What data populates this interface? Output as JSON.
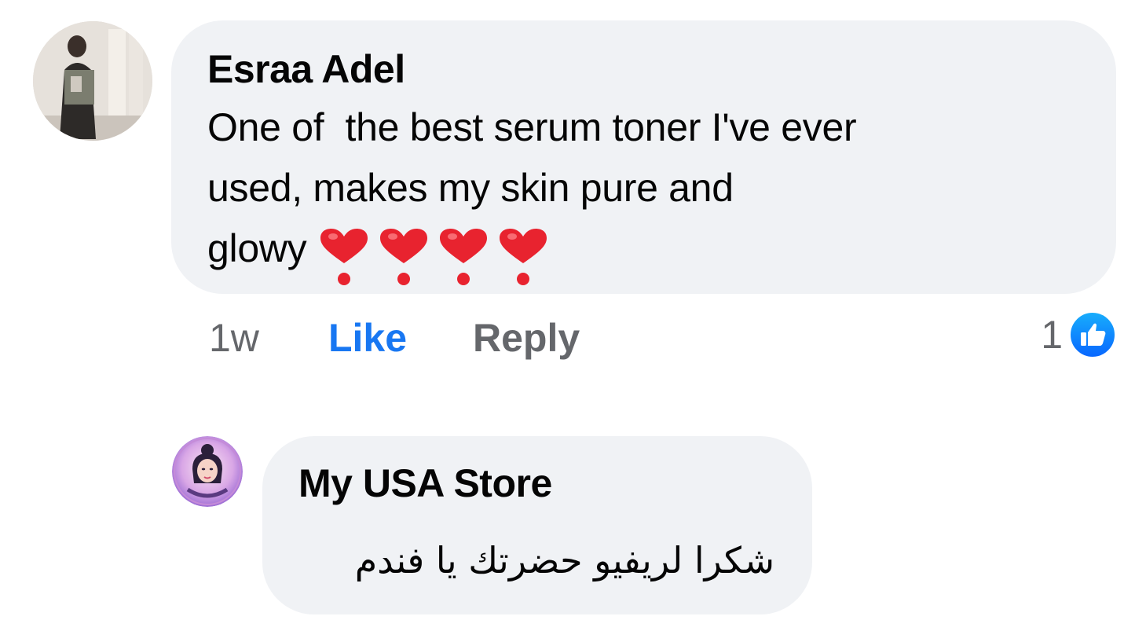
{
  "comment": {
    "author": "Esraa Adel",
    "text": "One of  the best serum toner I've ever\nused, makes my skin pure and\nglowy ",
    "emoji": [
      "heart-exclamation-icon",
      "heart-exclamation-icon",
      "heart-exclamation-icon",
      "heart-exclamation-icon"
    ],
    "time": "1w",
    "like_label": "Like",
    "reply_label": "Reply",
    "reaction_count": "1",
    "reaction_icon": "like-badge-icon"
  },
  "reply": {
    "author": "My USA Store",
    "text": "شكرا لريفيو حضرتك يا فندم"
  },
  "colors": {
    "bubble": "#f0f2f5",
    "link_blue": "#1877f2",
    "secondary_text": "#65676b",
    "heart_red": "#e8232f"
  }
}
